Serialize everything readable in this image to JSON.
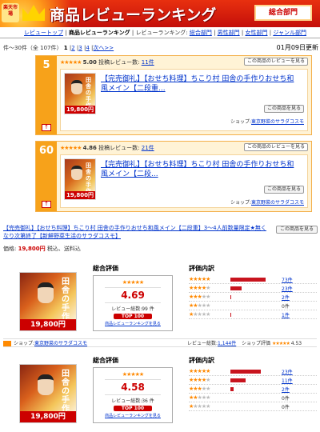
{
  "header": {
    "rakuten": "楽天市場",
    "title": "商品レビューランキング",
    "all_category": "総合部門"
  },
  "breadcrumb": {
    "top": "レビュートップ",
    "sep": "|",
    "current": "商品レビューランキング",
    "middle": "| レビューランキング:",
    "links": [
      "総合部門",
      "男性部門",
      "女性部門",
      "ジャンル部門"
    ]
  },
  "pager": {
    "range": "件～30件（全 107件）",
    "pages": [
      "1",
      "2",
      "3",
      "4"
    ],
    "current": "1",
    "next": "次へ>>"
  },
  "updated": "01月09日更新",
  "cards": [
    {
      "rank": "5",
      "rating": "5.00",
      "review_label": "投稿レビュー数:",
      "review_count": "11件",
      "see_reviews": "この商品のレビューを見る",
      "title": "【完売御礼】【おせち料理】ちこり村 田舎の手作りおせち和風メイン【二段重...",
      "go_label": "この商品を見る",
      "shop_label": "ショップ:",
      "shop": "東京野菜のサラダコスモ",
      "thumb_text": "田舎の手作り",
      "price_text": "19,800円"
    },
    {
      "rank": "60",
      "rating": "4.86",
      "review_label": "投稿レビュー数:",
      "review_count": "21件",
      "see_reviews": "この商品のレビューを見る",
      "title": "【完売御礼】【おせち料理】ちこり村 田舎の手作りおせち和風メイン【二段...",
      "go_label": "この商品を見る",
      "shop_label": "ショップ:",
      "shop": "東京野菜のサラダコスモ",
      "thumb_text": "田舎の手作り",
      "price_text": "19,800円"
    }
  ],
  "product": {
    "link": "【完売御礼】【おせち料理】ちこり村 田舎の手作りおせち和風メイン【二段重】3～4人前数量限定★無くなり次第終了【新鮮野菜生活のサラダコスモ】",
    "see_button": "この商品を見る",
    "price_label": "価格:",
    "price": "19,800円",
    "price_note": "税込、送料込"
  },
  "reviews": [
    {
      "summary_label": "総合評価",
      "score": "4.69",
      "count": "レビュー総数:99 件",
      "top": "TOP 100",
      "rank_link": "商品レビューランキングを見る",
      "dist_label": "評価内訳",
      "dist": [
        {
          "stars": 5,
          "frac": 0.74,
          "count": "73件"
        },
        {
          "stars": 4,
          "frac": 0.23,
          "count": "23件"
        },
        {
          "stars": 3,
          "frac": 0.02,
          "count": "2件"
        },
        {
          "stars": 2,
          "frac": 0,
          "count": "0件"
        },
        {
          "stars": 1,
          "frac": 0.01,
          "count": "1件"
        }
      ],
      "image_text": "田舎の手作り",
      "image_price": "19,800円"
    },
    {
      "summary_label": "総合評価",
      "score": "4.58",
      "count": "レビュー総数:36 件",
      "top": "TOP 100",
      "rank_link": "商品レビューランキングを見る",
      "dist_label": "評価内訳",
      "dist": [
        {
          "stars": 5,
          "frac": 0.64,
          "count": "23件"
        },
        {
          "stars": 4,
          "frac": 0.31,
          "count": "11件"
        },
        {
          "stars": 3,
          "frac": 0.06,
          "count": "2件"
        },
        {
          "stars": 2,
          "frac": 0,
          "count": "0件"
        },
        {
          "stars": 1,
          "frac": 0,
          "count": "0件"
        }
      ],
      "image_text": "田舎の手作り",
      "image_price": "19,800円"
    }
  ],
  "shopbar": {
    "label": "ショップ:",
    "shop": "東京野菜のサラダコスモ",
    "review_label": "レビュー総数:",
    "review_count": "1,144件",
    "shop_eval_label": "ショップ評価",
    "shop_eval": "4.53"
  },
  "colors": {
    "header_red": "#c40f0a",
    "card_orange": "#f7a21a",
    "bar_red": "#c8141e",
    "link_blue": "#0033cc"
  }
}
